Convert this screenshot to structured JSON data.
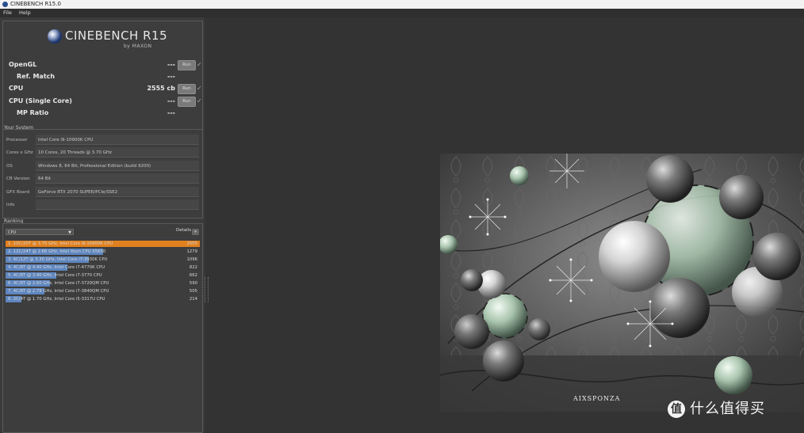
{
  "window": {
    "title": "CINEBENCH R15.0"
  },
  "menu": {
    "file": "File",
    "help": "Help"
  },
  "logo": {
    "name": "CINEBENCH R15",
    "by": "by MAXON"
  },
  "benchmarks": [
    {
      "label": "OpenGL",
      "value": "---",
      "button": "Run",
      "indent": false
    },
    {
      "label": "Ref. Match",
      "value": "---",
      "indent": true
    },
    {
      "label": "CPU",
      "value": "2555 cb",
      "button": "Run",
      "indent": false
    },
    {
      "label": "CPU (Single Core)",
      "value": "---",
      "button": "Run",
      "indent": false
    },
    {
      "label": "MP Ratio",
      "value": "---",
      "indent": true
    }
  ],
  "your_system": {
    "title": "Your System",
    "rows": [
      {
        "key": "Processor",
        "value": "Intel Core i9-10900K CPU"
      },
      {
        "key": "Cores x GHz",
        "value": "10 Cores, 20 Threads @ 3.70 GHz"
      },
      {
        "key": "OS",
        "value": "Windows 8, 64 Bit, Professional Edition (build 9200)"
      },
      {
        "key": "CB Version",
        "value": "64 Bit"
      },
      {
        "key": "GFX Board",
        "value": "GeForce RTX 2070 SUPER/PCIe/SSE2"
      },
      {
        "key": "Info",
        "value": ""
      }
    ]
  },
  "ranking": {
    "title": "Ranking",
    "select": "CPU",
    "details": "Details",
    "items": [
      {
        "text": "1. 10C/20T @ 3.70 GHz, Intel Core i9-10900K CPU",
        "score": "2555",
        "fraction": 1.0,
        "highlight": true
      },
      {
        "text": "2. 12C/24T @ 2.66 GHz, Intel Xeon CPU X5650",
        "score": "1279",
        "fraction": 0.5,
        "highlight": false
      },
      {
        "text": "3. 6C/12T @ 3.30 GHz,  Intel Core i7-3930K CPU",
        "score": "1096",
        "fraction": 0.43,
        "highlight": false
      },
      {
        "text": "4. 4C/8T @ 4.40 GHz, Intel Core i7-4770K CPU",
        "score": "822",
        "fraction": 0.32,
        "highlight": false
      },
      {
        "text": "5. 4C/8T @ 3.40 GHz,  Intel Core i7-3770 CPU",
        "score": "662",
        "fraction": 0.26,
        "highlight": false
      },
      {
        "text": "6. 4C/8T @ 2.60 GHz, Intel Core i7-3720QM CPU",
        "score": "590",
        "fraction": 0.23,
        "highlight": false
      },
      {
        "text": "7. 4C/8T @ 2.79 GHz,  Intel Core i7-3840QM CPU",
        "score": "505",
        "fraction": 0.2,
        "highlight": false
      },
      {
        "text": "8. 2C/4T @ 1.70 GHz,  Intel Core i5-3317U CPU",
        "score": "214",
        "fraction": 0.08,
        "highlight": false
      }
    ]
  },
  "render": {
    "credit": "AIXSPONZA"
  },
  "watermark": {
    "icon": "值",
    "text": "什么值得买"
  },
  "colors": {
    "highlight_bar": "#e0801e",
    "bar": "#5e86c0",
    "background": "#333333"
  }
}
